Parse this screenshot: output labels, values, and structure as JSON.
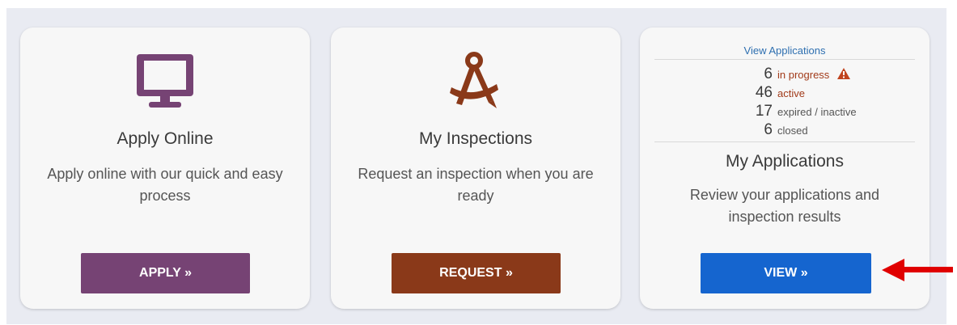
{
  "cards": {
    "apply": {
      "icon": "monitor-icon",
      "title": "Apply Online",
      "description": "Apply online with our quick and easy process",
      "button": "APPLY »"
    },
    "inspections": {
      "icon": "compass-drafting-icon",
      "title": "My Inspections",
      "description": "Request an inspection when you are ready",
      "button": "REQUEST »"
    },
    "applications": {
      "view_link": "View Applications",
      "stats": [
        {
          "count": "6",
          "label": "in progress",
          "warning": true
        },
        {
          "count": "46",
          "label": "active"
        },
        {
          "count": "17",
          "label": "expired / inactive"
        },
        {
          "count": "6",
          "label": "closed"
        }
      ],
      "title": "My Applications",
      "description": "Review your applications and inspection results",
      "button": "VIEW »"
    }
  },
  "colors": {
    "apply": "#764374",
    "request": "#8a3919",
    "view": "#1565cf",
    "warning": "#c0431e",
    "pointer_arrow": "#e00000"
  },
  "annotation": {
    "icon": "red-arrow-pointer-icon"
  }
}
